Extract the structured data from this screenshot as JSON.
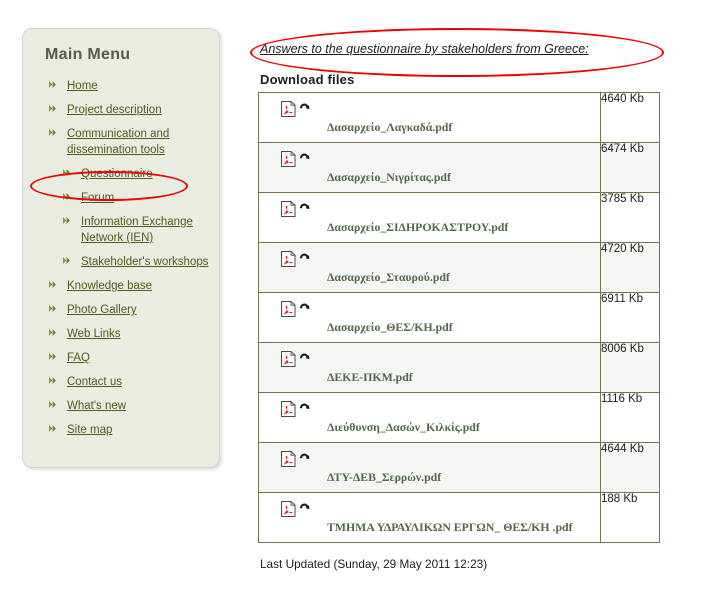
{
  "sidebar": {
    "title": "Main Menu",
    "bullet_icon": "double-chevron-icon",
    "items": [
      {
        "label": "Home",
        "sub": false,
        "highlighted": false
      },
      {
        "label": "Project description",
        "sub": false,
        "highlighted": false
      },
      {
        "label": "Communication and dissemination tools",
        "sub": false,
        "highlighted": false
      },
      {
        "label": "Questionnaire",
        "sub": true,
        "highlighted": true
      },
      {
        "label": "Forum",
        "sub": true,
        "highlighted": false
      },
      {
        "label": "Information Exchange Network (IEN)",
        "sub": true,
        "highlighted": false
      },
      {
        "label": "Stakeholder's workshops",
        "sub": true,
        "highlighted": false
      },
      {
        "label": "Knowledge base",
        "sub": false,
        "highlighted": false
      },
      {
        "label": "Photo Gallery",
        "sub": false,
        "highlighted": false
      },
      {
        "label": "Web Links",
        "sub": false,
        "highlighted": false
      },
      {
        "label": "FAQ",
        "sub": false,
        "highlighted": false
      },
      {
        "label": "Contact us",
        "sub": false,
        "highlighted": false
      },
      {
        "label": "What's new",
        "sub": false,
        "highlighted": false
      },
      {
        "label": "Site map",
        "sub": false,
        "highlighted": false
      }
    ]
  },
  "main": {
    "page_title": "Answers to the questionnaire by stakeholders from Greece:",
    "download_heading": "Download files",
    "last_updated": "Last Updated (Sunday, 29 May 2011 12:23)",
    "file_icon": "pdf-document-icon",
    "action_icon": "reload-arrow-icon",
    "files": [
      {
        "name": "Δασαρχείο_Λαγκαδά.pdf",
        "size": "4640 Kb"
      },
      {
        "name": "Δασαρχείο_Νιγρίτας.pdf",
        "size": "6474 Kb"
      },
      {
        "name": "Δασαρχείο_ΣΙΔΗΡΟΚΑΣΤΡΟΥ.pdf",
        "size": "3785 Kb"
      },
      {
        "name": "Δασαρχείο_Σταυρού.pdf",
        "size": "4720 Kb"
      },
      {
        "name": "Δασαρχείο_ΘΕΣ/ΚΗ.pdf",
        "size": "6911 Kb"
      },
      {
        "name": "ΔΕΚΕ-ΠΚΜ.pdf",
        "size": "8006 Kb"
      },
      {
        "name": "Διεύθυνση_Δασών_Κιλκίς.pdf",
        "size": "1116 Kb"
      },
      {
        "name": "ΔΤΥ-ΔΕΒ_Σερρών.pdf",
        "size": "4644 Kb"
      },
      {
        "name": "ΤΜΗΜΑ ΥΔΡΑΥΛΙΚΩΝ ΕΡΓΩΝ_ ΘΕΣ/ΚΗ .pdf",
        "size": "188 Kb"
      }
    ]
  },
  "annotations": {
    "color": "#ee0000",
    "title_ellipse": "red-ellipse-annotation-title",
    "menu_ellipse": "red-ellipse-annotation-questionnaire"
  }
}
